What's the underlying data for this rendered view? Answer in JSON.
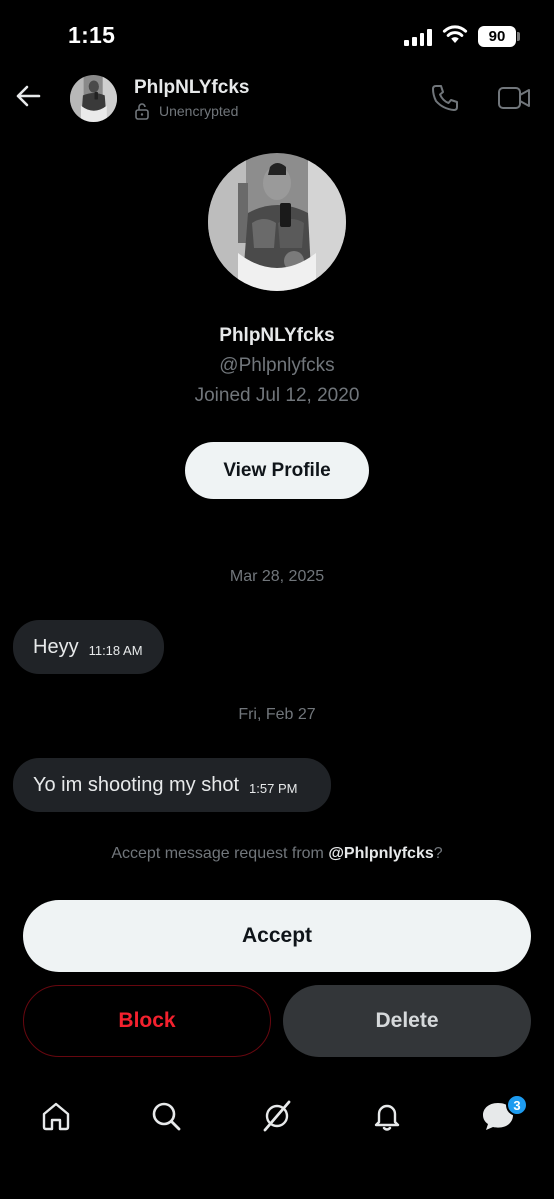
{
  "status_bar": {
    "time": "1:15",
    "battery": "90"
  },
  "header": {
    "name": "PhlpNLYfcks",
    "encryption": "Unencrypted"
  },
  "profile": {
    "name": "PhlpNLYfcks",
    "handle": "@Phlpnlyfcks",
    "joined": "Joined Jul 12, 2020",
    "view_profile": "View Profile"
  },
  "messages": [
    {
      "date": "Mar 28, 2025",
      "text": "Heyy",
      "time": "11:18 AM"
    },
    {
      "date": "Fri, Feb 27",
      "text": "Yo im shooting my shot",
      "time": "1:57 PM"
    }
  ],
  "request": {
    "prefix": "Accept message request from ",
    "handle": "@Phlpnlyfcks",
    "suffix": "?"
  },
  "actions": {
    "accept": "Accept",
    "block": "Block",
    "delete": "Delete"
  },
  "tabbar": {
    "icons": [
      "home-icon",
      "search-icon",
      "grok-icon",
      "notifications-icon",
      "messages-icon"
    ],
    "messages_badge": "3"
  },
  "colors": {
    "accent": "#1d9bf0",
    "danger": "#f4212e",
    "bubble": "#202327"
  }
}
